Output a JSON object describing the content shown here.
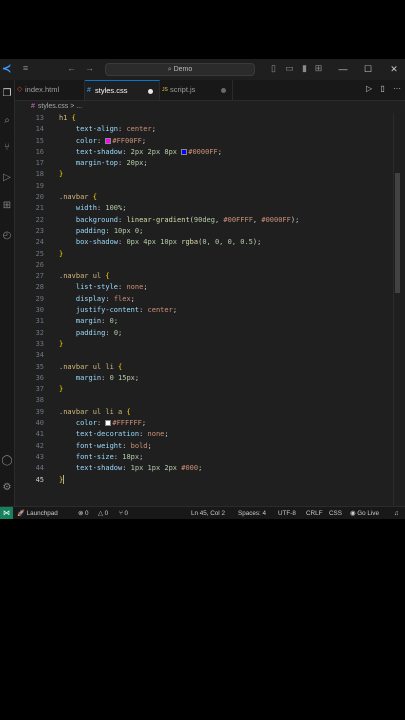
{
  "titlebar": {
    "menus": [
      "≡",
      "⊞"
    ],
    "nav_back": "←",
    "nav_forward": "→",
    "search_text": "Demo",
    "layout_icons": [
      "▯",
      "▭",
      "▮",
      "⊞"
    ],
    "minimize": "—",
    "maximize": "☐",
    "close": "✕"
  },
  "tabs": [
    {
      "label": "index.html",
      "icon": "◇",
      "icon_color": "#e34c26",
      "active": false
    },
    {
      "label": "styles.css",
      "icon": "#",
      "icon_color": "#42a5f5",
      "active": true
    },
    {
      "label": "script.js",
      "icon": "JS",
      "icon_color": "#e8c14a",
      "active": false
    }
  ],
  "tab_actions": {
    "run": "▷",
    "split": "▯",
    "more": "···"
  },
  "breadcrumb": {
    "file": "styles.css",
    "sep": "> ..."
  },
  "activity_icons": [
    "files-icon",
    "search-icon",
    "source-control-icon",
    "run-debug-icon",
    "extensions-icon",
    "remote-explorer-icon"
  ],
  "editor": {
    "lines": [
      {
        "n": "13",
        "tokens": [
          [
            "sel",
            "h1 "
          ],
          [
            "brace",
            "{"
          ]
        ]
      },
      {
        "n": "14",
        "tokens": [
          [
            "sp",
            "    "
          ],
          [
            "prop",
            "text-align"
          ],
          [
            "punc",
            ": "
          ],
          [
            "val",
            "center"
          ],
          [
            "punc",
            ";"
          ]
        ]
      },
      {
        "n": "15",
        "tokens": [
          [
            "sp",
            "    "
          ],
          [
            "prop",
            "color"
          ],
          [
            "punc",
            ": "
          ],
          [
            "swatch",
            "#FF00FF"
          ],
          [
            "val",
            "#FF00FF"
          ],
          [
            "punc",
            ";"
          ]
        ]
      },
      {
        "n": "16",
        "tokens": [
          [
            "sp",
            "    "
          ],
          [
            "prop",
            "text-shadow"
          ],
          [
            "punc",
            ": "
          ],
          [
            "num",
            "2px 2px 8px "
          ],
          [
            "swatch",
            "#0000FF"
          ],
          [
            "val",
            "#0000FF"
          ],
          [
            "punc",
            ";"
          ]
        ]
      },
      {
        "n": "17",
        "tokens": [
          [
            "sp",
            "    "
          ],
          [
            "prop",
            "margin-top"
          ],
          [
            "punc",
            ": "
          ],
          [
            "num",
            "20px"
          ],
          [
            "punc",
            ";"
          ]
        ]
      },
      {
        "n": "18",
        "tokens": [
          [
            "brace",
            "}"
          ]
        ]
      },
      {
        "n": "19",
        "tokens": []
      },
      {
        "n": "20",
        "tokens": [
          [
            "sel",
            ".navbar "
          ],
          [
            "brace",
            "{"
          ]
        ]
      },
      {
        "n": "21",
        "tokens": [
          [
            "sp",
            "    "
          ],
          [
            "prop",
            "width"
          ],
          [
            "punc",
            ": "
          ],
          [
            "num",
            "100%"
          ],
          [
            "punc",
            ";"
          ]
        ]
      },
      {
        "n": "22",
        "tokens": [
          [
            "sp",
            "    "
          ],
          [
            "prop",
            "background"
          ],
          [
            "punc",
            ": "
          ],
          [
            "kw",
            "linear-gradient"
          ],
          [
            "punc",
            "("
          ],
          [
            "num",
            "90deg"
          ],
          [
            "punc",
            ", "
          ],
          [
            "val",
            "#00FFFF"
          ],
          [
            "punc",
            ", "
          ],
          [
            "val",
            "#0000FF"
          ],
          [
            "punc",
            ");"
          ]
        ]
      },
      {
        "n": "23",
        "tokens": [
          [
            "sp",
            "    "
          ],
          [
            "prop",
            "padding"
          ],
          [
            "punc",
            ": "
          ],
          [
            "num",
            "10px 0"
          ],
          [
            "punc",
            ";"
          ]
        ]
      },
      {
        "n": "24",
        "tokens": [
          [
            "sp",
            "    "
          ],
          [
            "prop",
            "box-shadow"
          ],
          [
            "punc",
            ": "
          ],
          [
            "num",
            "0px 4px 10px "
          ],
          [
            "kw",
            "rgba"
          ],
          [
            "punc",
            "("
          ],
          [
            "num",
            "0, 0, 0, 0.5"
          ],
          [
            "punc",
            ");"
          ]
        ]
      },
      {
        "n": "25",
        "tokens": [
          [
            "brace",
            "}"
          ]
        ]
      },
      {
        "n": "26",
        "tokens": []
      },
      {
        "n": "27",
        "tokens": [
          [
            "sel",
            ".navbar ul "
          ],
          [
            "brace",
            "{"
          ]
        ]
      },
      {
        "n": "28",
        "tokens": [
          [
            "sp",
            "    "
          ],
          [
            "prop",
            "list-style"
          ],
          [
            "punc",
            ": "
          ],
          [
            "val",
            "none"
          ],
          [
            "punc",
            ";"
          ]
        ]
      },
      {
        "n": "29",
        "tokens": [
          [
            "sp",
            "    "
          ],
          [
            "prop",
            "display"
          ],
          [
            "punc",
            ": "
          ],
          [
            "val",
            "flex"
          ],
          [
            "punc",
            ";"
          ]
        ]
      },
      {
        "n": "30",
        "tokens": [
          [
            "sp",
            "    "
          ],
          [
            "prop",
            "justify-content"
          ],
          [
            "punc",
            ": "
          ],
          [
            "val",
            "center"
          ],
          [
            "punc",
            ";"
          ]
        ]
      },
      {
        "n": "31",
        "tokens": [
          [
            "sp",
            "    "
          ],
          [
            "prop",
            "margin"
          ],
          [
            "punc",
            ": "
          ],
          [
            "num",
            "0"
          ],
          [
            "punc",
            ";"
          ]
        ]
      },
      {
        "n": "32",
        "tokens": [
          [
            "sp",
            "    "
          ],
          [
            "prop",
            "padding"
          ],
          [
            "punc",
            ": "
          ],
          [
            "num",
            "0"
          ],
          [
            "punc",
            ";"
          ]
        ]
      },
      {
        "n": "33",
        "tokens": [
          [
            "brace",
            "}"
          ]
        ]
      },
      {
        "n": "34",
        "tokens": []
      },
      {
        "n": "35",
        "tokens": [
          [
            "sel",
            ".navbar ul li "
          ],
          [
            "brace",
            "{"
          ]
        ]
      },
      {
        "n": "36",
        "tokens": [
          [
            "sp",
            "    "
          ],
          [
            "prop",
            "margin"
          ],
          [
            "punc",
            ": "
          ],
          [
            "num",
            "0 15px"
          ],
          [
            "punc",
            ";"
          ]
        ]
      },
      {
        "n": "37",
        "tokens": [
          [
            "brace",
            "}"
          ]
        ]
      },
      {
        "n": "38",
        "tokens": []
      },
      {
        "n": "39",
        "tokens": [
          [
            "sel",
            ".navbar ul li a "
          ],
          [
            "brace",
            "{"
          ]
        ]
      },
      {
        "n": "40",
        "tokens": [
          [
            "sp",
            "    "
          ],
          [
            "prop",
            "color"
          ],
          [
            "punc",
            ": "
          ],
          [
            "swatch",
            "#FFFFFF"
          ],
          [
            "val",
            "#FFFFFF"
          ],
          [
            "punc",
            ";"
          ]
        ]
      },
      {
        "n": "41",
        "tokens": [
          [
            "sp",
            "    "
          ],
          [
            "prop",
            "text-decoration"
          ],
          [
            "punc",
            ": "
          ],
          [
            "val",
            "none"
          ],
          [
            "punc",
            ";"
          ]
        ]
      },
      {
        "n": "42",
        "tokens": [
          [
            "sp",
            "    "
          ],
          [
            "prop",
            "font-weight"
          ],
          [
            "punc",
            ": "
          ],
          [
            "val",
            "bold"
          ],
          [
            "punc",
            ";"
          ]
        ]
      },
      {
        "n": "43",
        "tokens": [
          [
            "sp",
            "    "
          ],
          [
            "prop",
            "font-size"
          ],
          [
            "punc",
            ": "
          ],
          [
            "num",
            "18px"
          ],
          [
            "punc",
            ";"
          ]
        ]
      },
      {
        "n": "44",
        "tokens": [
          [
            "sp",
            "    "
          ],
          [
            "prop",
            "text-shadow"
          ],
          [
            "punc",
            ": "
          ],
          [
            "num",
            "1px 1px 2px "
          ],
          [
            "val",
            "#000"
          ],
          [
            "punc",
            ";"
          ]
        ]
      },
      {
        "n": "45",
        "tokens": [
          [
            "brace",
            "}"
          ],
          [
            "caret",
            ""
          ]
        ],
        "current": true
      }
    ]
  },
  "status": {
    "remote_icon": "⋈",
    "launchpad": "Launchpad",
    "errors": "⊗ 0",
    "warnings": "△ 0",
    "ports": "⑂ 0",
    "position": "Ln 45, Col 2",
    "spaces": "Spaces: 4",
    "encoding": "UTF-8",
    "eol": "CRLF",
    "language": "CSS",
    "golive": "Go Live",
    "bell": "🔔"
  }
}
